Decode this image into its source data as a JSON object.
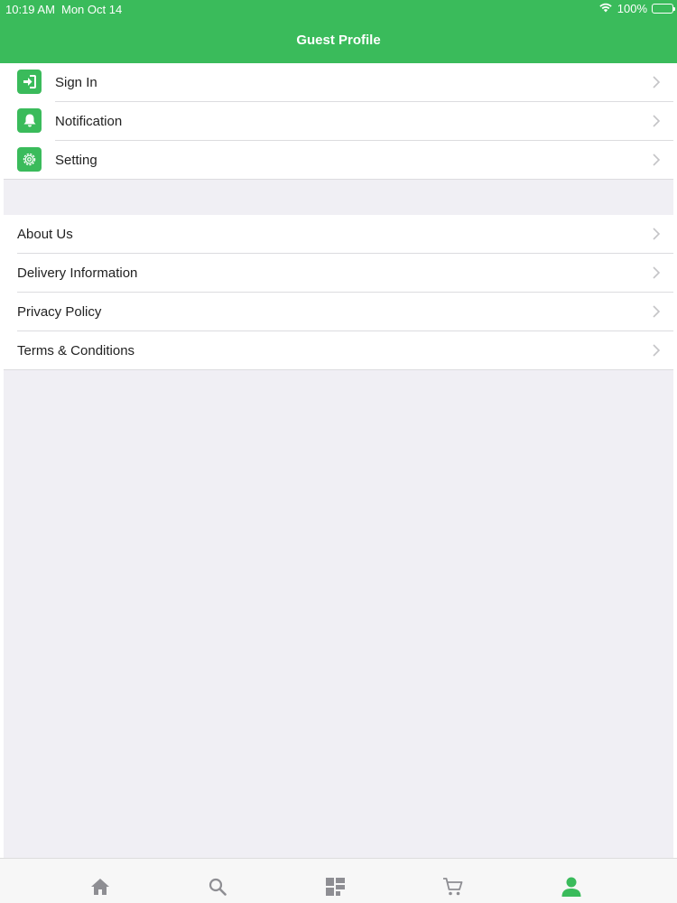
{
  "status_bar": {
    "time": "10:19 AM",
    "date": "Mon Oct 14",
    "battery": "100%"
  },
  "header": {
    "title": "Guest Profile"
  },
  "menu_group_1": [
    {
      "label": "Sign In",
      "icon": "sign-in-icon"
    },
    {
      "label": "Notification",
      "icon": "bell-icon"
    },
    {
      "label": "Setting",
      "icon": "gear-icon"
    }
  ],
  "menu_group_2": [
    {
      "label": "About Us"
    },
    {
      "label": "Delivery Information"
    },
    {
      "label": "Privacy Policy"
    },
    {
      "label": "Terms & Conditions"
    }
  ],
  "tabs": [
    {
      "icon": "home-icon",
      "active": false
    },
    {
      "icon": "search-icon",
      "active": false
    },
    {
      "icon": "categories-icon",
      "active": false
    },
    {
      "icon": "cart-icon",
      "active": false
    },
    {
      "icon": "profile-icon",
      "active": true
    }
  ],
  "colors": {
    "accent": "#3abb5b",
    "background": "#f0eff4",
    "tab_inactive": "#8e8e93"
  }
}
